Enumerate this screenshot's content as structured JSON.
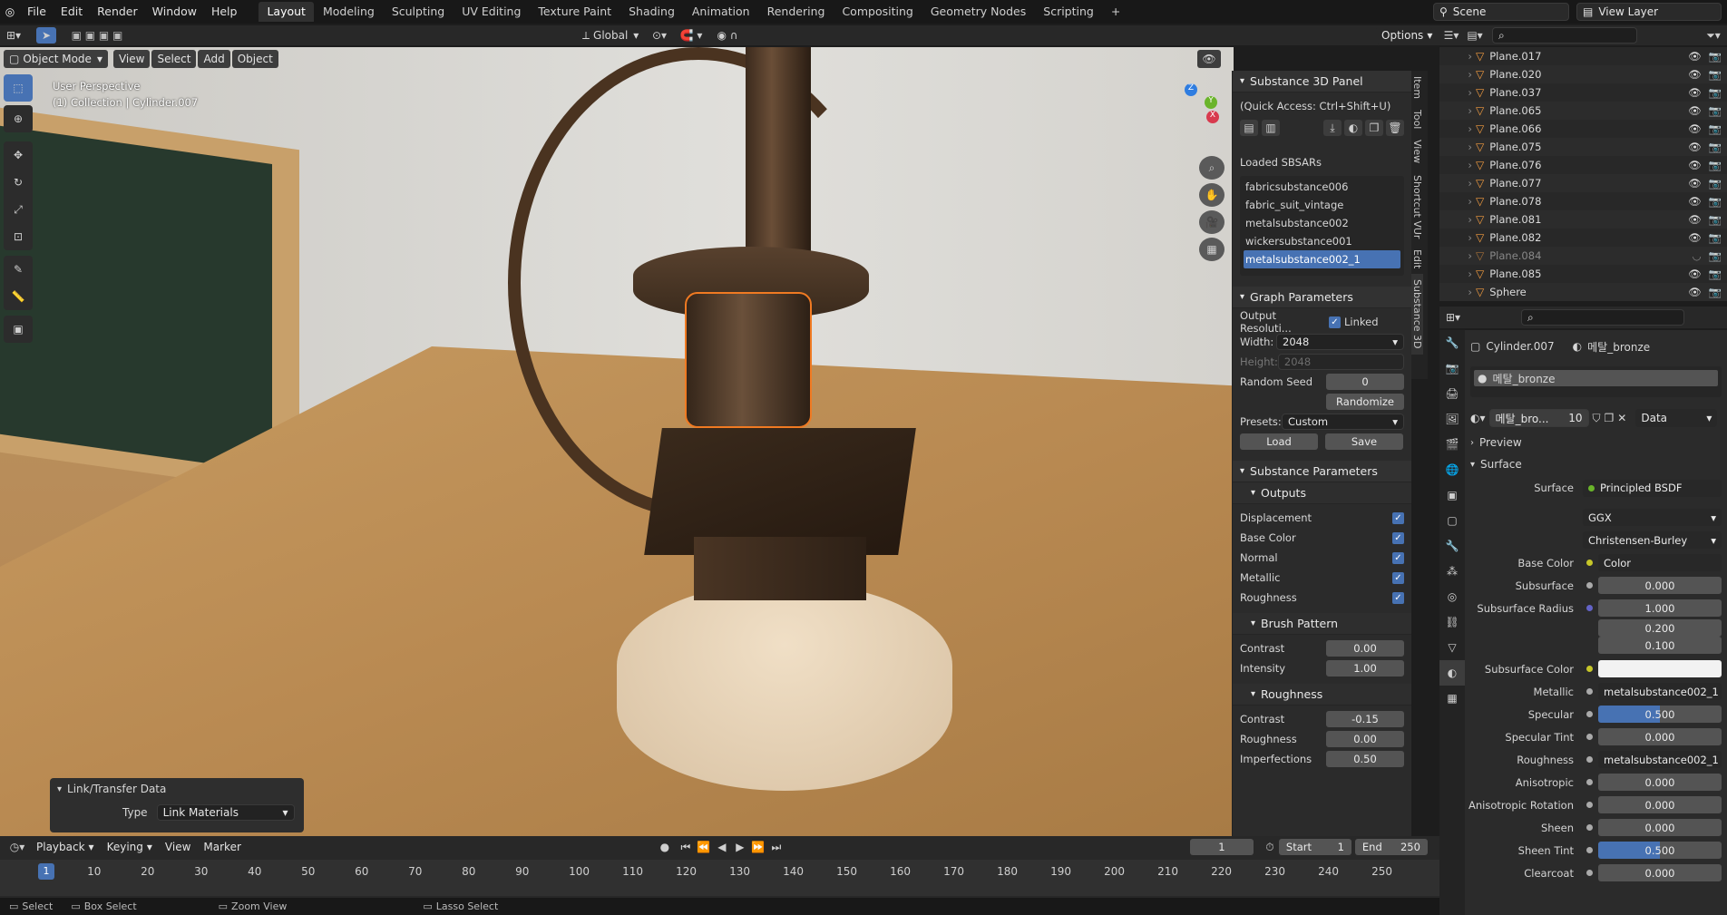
{
  "topbar": {
    "menus": [
      "File",
      "Edit",
      "Render",
      "Window",
      "Help"
    ],
    "workspaces": [
      "Layout",
      "Modeling",
      "Sculpting",
      "UV Editing",
      "Texture Paint",
      "Shading",
      "Animation",
      "Rendering",
      "Compositing",
      "Geometry Nodes",
      "Scripting"
    ],
    "active_workspace": "Layout",
    "scene": "Scene",
    "view_layer": "View Layer"
  },
  "toolbar": {
    "transform": "Global",
    "options": "Options"
  },
  "viewport_header": {
    "mode": "Object Mode",
    "menus": [
      "View",
      "Select",
      "Add",
      "Object"
    ]
  },
  "viewport": {
    "perspective": "User Perspective",
    "collection": "(1) Collection | Cylinder.007"
  },
  "link_panel": {
    "title": "Link/Transfer Data",
    "type_label": "Type",
    "type_value": "Link Materials"
  },
  "substance": {
    "panel_title": "Substance 3D Panel",
    "quick_access": "(Quick Access: Ctrl+Shift+U)",
    "loaded_label": "Loaded SBSARs",
    "sbsars": [
      "fabricsubstance006",
      "fabric_suit_vintage",
      "metalsubstance002",
      "wickersubstance001",
      "metalsubstance002_1"
    ],
    "selected_sbsar": "metalsubstance002_1",
    "graph_params_title": "Graph Parameters",
    "output_res_label": "Output Resoluti...",
    "linked_label": "Linked",
    "width_label": "Width:",
    "width_value": "2048",
    "height_label": "Height:",
    "height_value": "2048",
    "random_seed_label": "Random Seed",
    "random_seed_value": "0",
    "randomize_label": "Randomize",
    "presets_label": "Presets:",
    "presets_value": "Custom",
    "load_label": "Load",
    "save_label": "Save",
    "sub_params_title": "Substance Parameters",
    "outputs_title": "Outputs",
    "outputs": [
      "Displacement",
      "Base Color",
      "Normal",
      "Metallic",
      "Roughness"
    ],
    "brush_title": "Brush Pattern",
    "brush_contrast_label": "Contrast",
    "brush_contrast": "0.00",
    "brush_intensity_label": "Intensity",
    "brush_intensity": "1.00",
    "rough_title": "Roughness",
    "rough_contrast_label": "Contrast",
    "rough_contrast": "-0.15",
    "rough_roughness_label": "Roughness",
    "rough_roughness": "0.00",
    "rough_imperfections_label": "Imperfections",
    "rough_imperfections": "0.50"
  },
  "side_tabs": [
    "Item",
    "Tool",
    "View",
    "Shortcut VUr",
    "Edit",
    "Substance 3D"
  ],
  "outliner": {
    "rows": [
      "Plane.017",
      "Plane.020",
      "Plane.037",
      "Plane.065",
      "Plane.066",
      "Plane.075",
      "Plane.076",
      "Plane.077",
      "Plane.078",
      "Plane.081",
      "Plane.082",
      "Plane.084",
      "Plane.085",
      "Sphere"
    ]
  },
  "properties": {
    "object": "Cylinder.007",
    "material": "메탈_bronze",
    "slot": "메탈_bronze",
    "mat_short": "메탈_bro...",
    "users": "10",
    "data_label": "Data",
    "preview": "Preview",
    "surface_section": "Surface",
    "surface_label": "Surface",
    "surface_value": "Principled BSDF",
    "distribution": "GGX",
    "subsurface_method": "Christensen-Burley",
    "rows": [
      {
        "label": "Base Color",
        "value": "Color"
      },
      {
        "label": "Subsurface",
        "value": "0.000"
      },
      {
        "label": "Subsurface Radius",
        "value": "1.000"
      },
      {
        "label": "",
        "value": "0.200"
      },
      {
        "label": "",
        "value": "0.100"
      },
      {
        "label": "Subsurface Color",
        "value": ""
      },
      {
        "label": "Metallic",
        "value": "metalsubstance002_1"
      },
      {
        "label": "Specular",
        "value": "0.500"
      },
      {
        "label": "Specular Tint",
        "value": "0.000"
      },
      {
        "label": "Roughness",
        "value": "metalsubstance002_1"
      },
      {
        "label": "Anisotropic",
        "value": "0.000"
      },
      {
        "label": "Anisotropic Rotation",
        "value": "0.000"
      },
      {
        "label": "Sheen",
        "value": "0.000"
      },
      {
        "label": "Sheen Tint",
        "value": "0.500"
      },
      {
        "label": "Clearcoat",
        "value": "0.000"
      }
    ]
  },
  "timeline": {
    "menus": [
      "Playback",
      "Keying",
      "View",
      "Marker"
    ],
    "current_frame": "1",
    "start_label": "Start",
    "start": "1",
    "end_label": "End",
    "end": "250",
    "ticks": [
      "1",
      "10",
      "20",
      "30",
      "40",
      "50",
      "60",
      "70",
      "80",
      "90",
      "100",
      "110",
      "120",
      "130",
      "140",
      "150",
      "160",
      "170",
      "180",
      "190",
      "200",
      "210",
      "220",
      "230",
      "240",
      "250"
    ]
  },
  "statusbar": {
    "items": [
      "Select",
      "Box Select",
      "Zoom View",
      "Lasso Select"
    ]
  }
}
